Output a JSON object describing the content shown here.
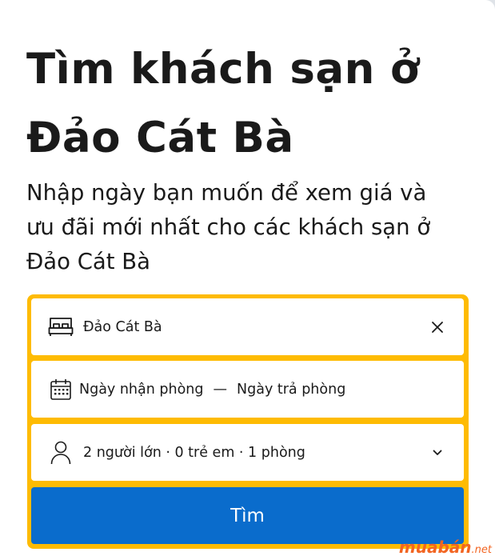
{
  "header": {
    "title_line1": "Tìm khách sạn ở",
    "title_line2": "Đảo Cát Bà",
    "subtitle_line1": "Nhập ngày bạn muốn để xem giá và",
    "subtitle_line2": "ưu đãi mới nhất cho các khách sạn ở",
    "subtitle_line3": "Đảo Cát Bà"
  },
  "search": {
    "destination": {
      "value": "Đảo Cát Bà",
      "icon": "bed-icon",
      "clear_icon": "close-icon"
    },
    "dates": {
      "checkin_placeholder": "Ngày nhận phòng",
      "separator": "—",
      "checkout_placeholder": "Ngày trả phòng",
      "icon": "calendar-icon"
    },
    "guests": {
      "value": "2 người lớn · 0 trẻ em · 1 phòng",
      "icon": "person-icon",
      "chevron_icon": "chevron-down-icon"
    },
    "button_label": "Tìm"
  },
  "watermark": {
    "brand": "muabán",
    "tld": ".net"
  },
  "colors": {
    "accent_yellow": "#febb02",
    "button_blue": "#0a6ccc",
    "text": "#1a1a1a",
    "watermark": "#f26522"
  }
}
